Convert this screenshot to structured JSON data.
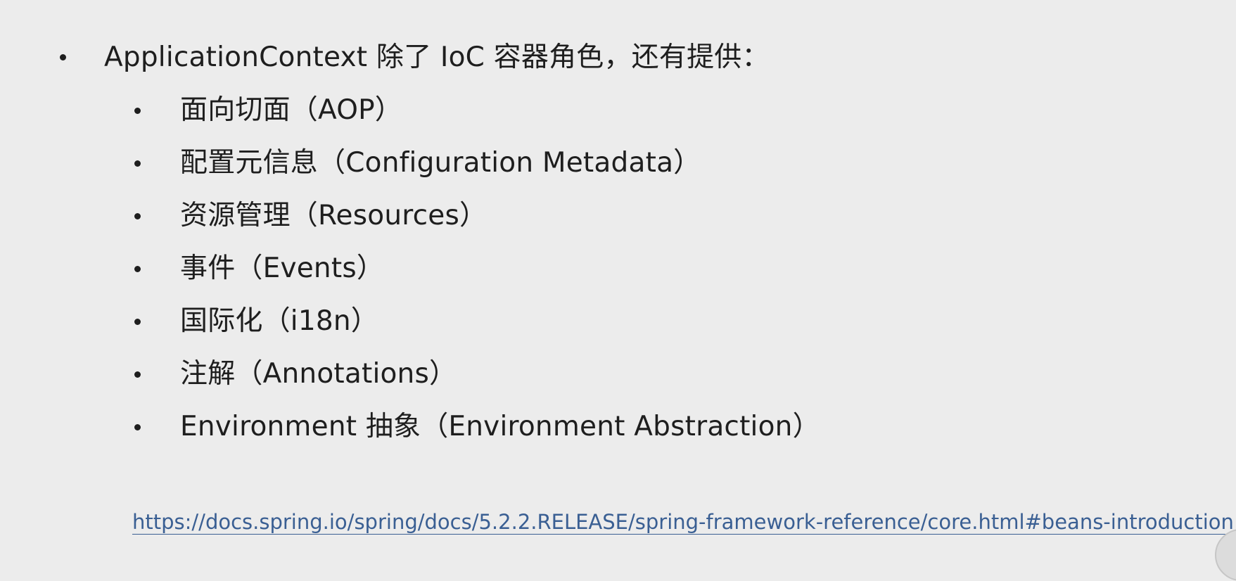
{
  "main_bullet": "ApplicationContext 除了 IoC 容器角色，还有提供：",
  "sub_bullets": [
    "面向切面（AOP）",
    "配置元信息（Configuration Metadata）",
    "资源管理（Resources）",
    "事件（Events）",
    "国际化（i18n）",
    "注解（Annotations）",
    "Environment 抽象（Environment Abstraction）"
  ],
  "reference_link": "https://docs.spring.io/spring/docs/5.2.2.RELEASE/spring-framework-reference/core.html#beans-introduction"
}
